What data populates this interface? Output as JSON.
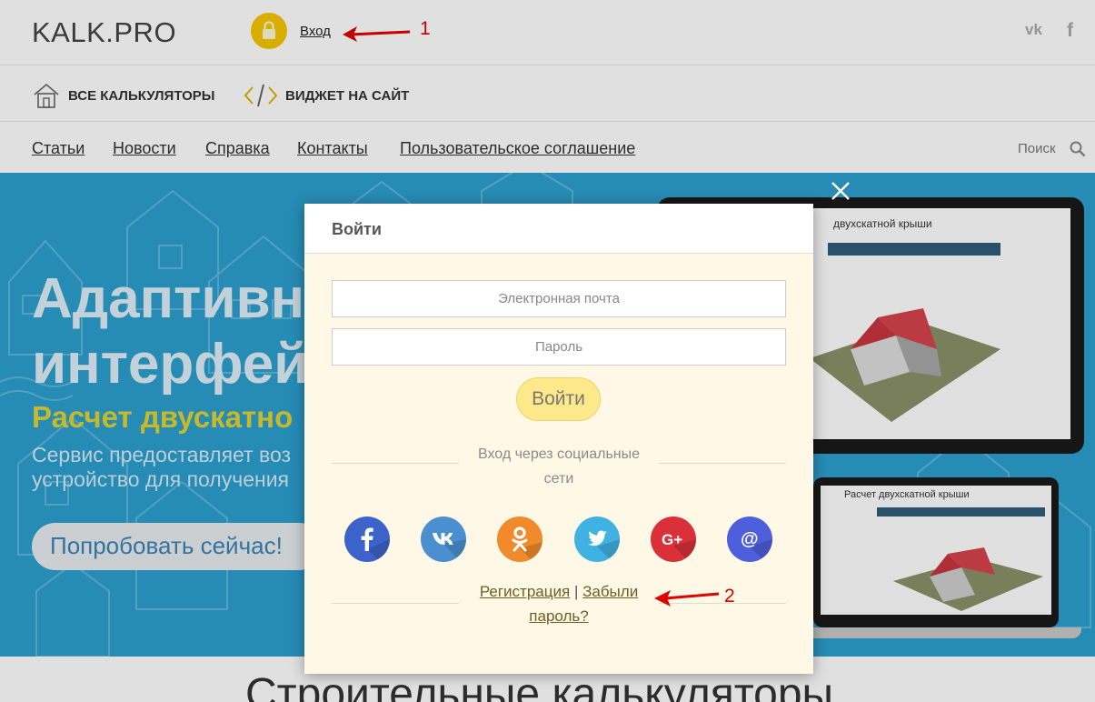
{
  "topbar": {
    "logo": "KALK.PRO",
    "login_link": "Вход",
    "annotation_1": "1",
    "social": [
      "vk-icon",
      "facebook-icon"
    ]
  },
  "navbar": {
    "items": [
      "ВСЕ КАЛЬКУЛЯТОРЫ",
      "ВИДЖЕТ НА САЙТ"
    ]
  },
  "links": {
    "items": [
      "Статьи",
      "Новости",
      "Справка",
      "Контакты",
      "Пользовательское соглашение"
    ],
    "search_label": "Поиск"
  },
  "hero": {
    "headline_line1": "Адаптивны",
    "headline_line2": "интерфейс",
    "subtitle": "Расчет двускатно",
    "desc_line1": "Сервис предоставляет воз",
    "desc_line2": "устройство для получения",
    "cta": "Попробовать сейчас!",
    "laptop_title": "двухскатной крыши",
    "laptop2_title": "Расчет двухскатной крыши"
  },
  "bottom_section": {
    "title": "Строительные калькуляторы"
  },
  "modal": {
    "title": "Войти",
    "email_placeholder": "Электронная почта",
    "password_placeholder": "Пароль",
    "submit": "Войти",
    "social_caption": "Вход через социальные сети",
    "social_buttons": [
      {
        "name": "facebook",
        "color": "#3b63c9"
      },
      {
        "name": "vk",
        "color": "#4a90d1"
      },
      {
        "name": "odnoklassniki",
        "color": "#f08a2a"
      },
      {
        "name": "twitter",
        "color": "#3fb1e3"
      },
      {
        "name": "google-plus",
        "color": "#d9303a"
      },
      {
        "name": "mailru",
        "color": "#4e5fdc"
      }
    ],
    "register_link": "Регистрация",
    "separator": "|",
    "forgot_link": "Забыли пароль?",
    "annotation_2": "2"
  },
  "colors": {
    "accent_yellow": "#f6c700",
    "hero_blue": "#2c9fcf",
    "modal_bg": "#fff8e6",
    "annotation_red": "#e00000"
  }
}
